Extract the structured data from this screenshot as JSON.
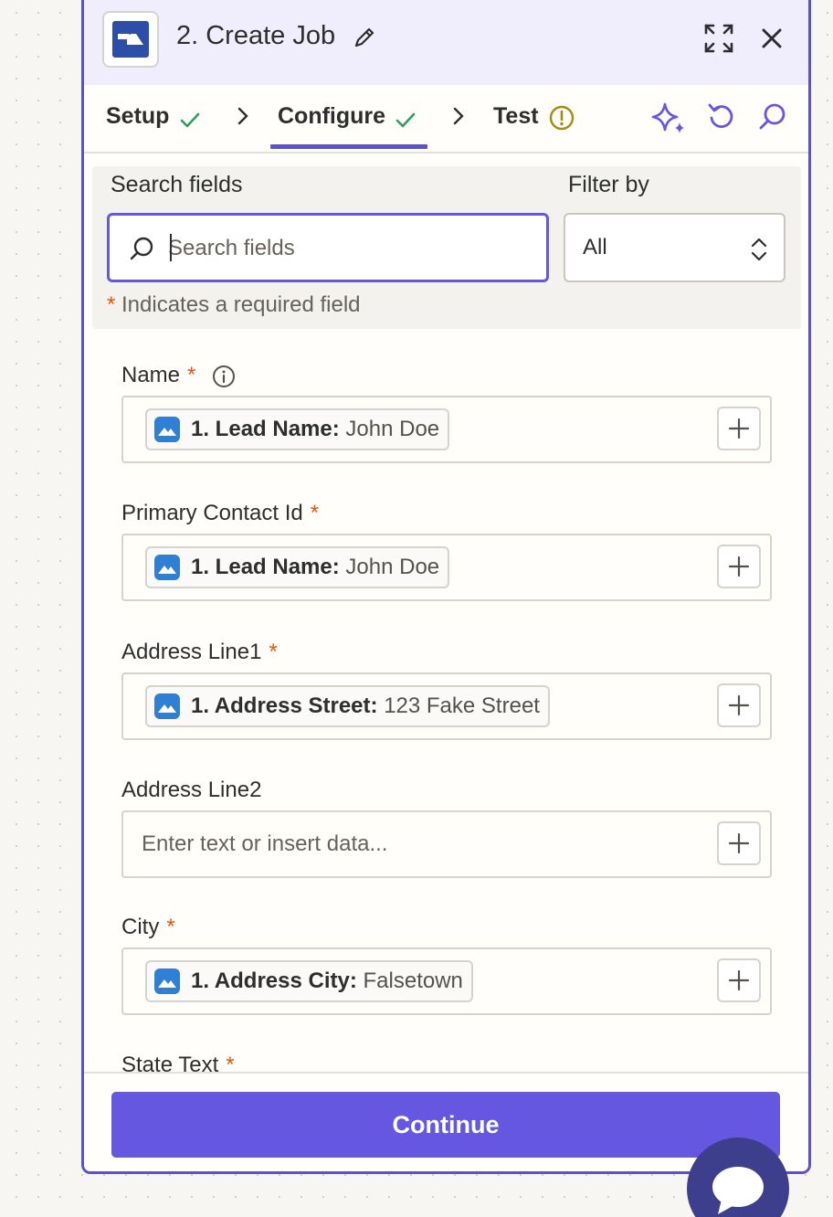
{
  "header": {
    "title": "2. Create Job"
  },
  "tabs": {
    "setup": "Setup",
    "configure": "Configure",
    "test": "Test"
  },
  "search": {
    "label": "Search fields",
    "placeholder": "Search fields",
    "filter_label": "Filter by",
    "filter_value": "All",
    "required_star": "*",
    "required_note": "Indicates a required field"
  },
  "fields": [
    {
      "label": "Name",
      "required": "*",
      "pill_key": "1. Lead Name:",
      "pill_value": "John Doe"
    },
    {
      "label": "Primary Contact Id",
      "required": "*",
      "pill_key": "1. Lead Name:",
      "pill_value": "John Doe"
    },
    {
      "label": "Address Line1",
      "required": "*",
      "pill_key": "1. Address Street:",
      "pill_value": "123 Fake Street"
    },
    {
      "label": "Address Line2",
      "placeholder": "Enter text or insert data..."
    },
    {
      "label": "City",
      "required": "*",
      "pill_key": "1. Address City:",
      "pill_value": "Falsetown"
    },
    {
      "label": "State Text",
      "required": "*"
    }
  ],
  "footer": {
    "continue_label": "Continue"
  },
  "colors": {
    "accent": "#6557e0",
    "panel_border": "#5c52c9",
    "check": "#2f9e5e",
    "warning": "#a8890f",
    "required": "#e8540f",
    "chat": "#3d3f8c"
  },
  "icons": [
    "app-logo",
    "pencil-icon",
    "expand-icon",
    "close-icon",
    "check-icon",
    "chevron-right-icon",
    "warning-icon",
    "sparkle-icon",
    "undo-icon",
    "search-icon",
    "updown-icon",
    "info-icon",
    "mountain-app-icon",
    "plus-icon",
    "chat-icon"
  ]
}
